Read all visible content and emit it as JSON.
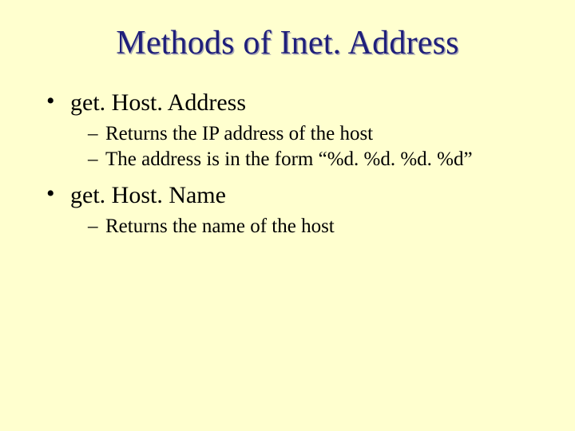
{
  "title": "Methods of Inet. Address",
  "bullets": [
    {
      "label": "get. Host. Address",
      "sub": [
        "Returns the IP address of the host",
        "The address is in the form “%d. %d. %d. %d”"
      ]
    },
    {
      "label": "get. Host. Name",
      "sub": [
        "Returns the name of the host"
      ]
    }
  ]
}
